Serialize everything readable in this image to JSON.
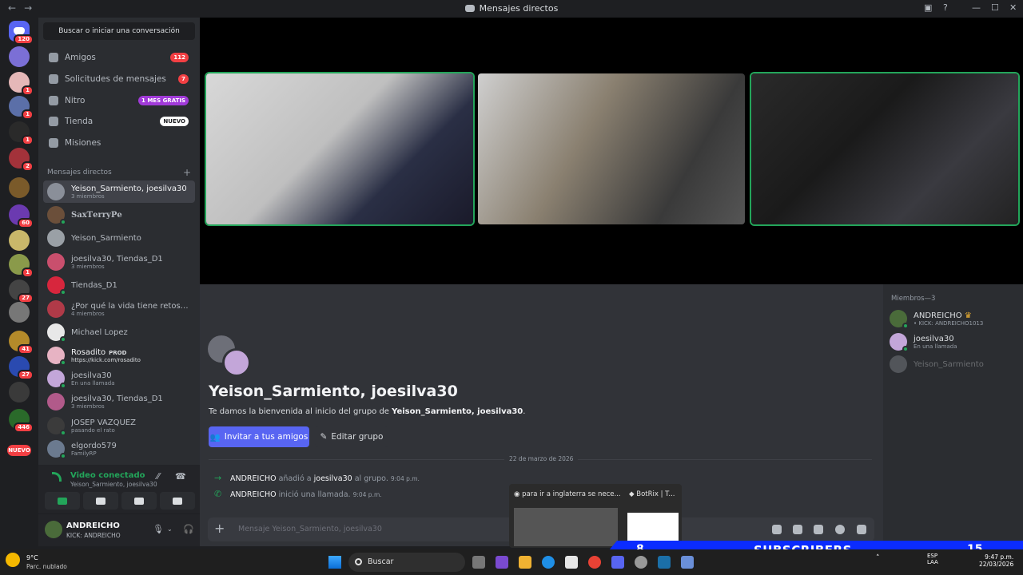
{
  "window": {
    "title": "Mensajes directos",
    "back": "←",
    "forward": "→",
    "minimize": "—",
    "maximize": "☐",
    "close": "✕"
  },
  "servers": {
    "home_badge": "120",
    "badges": [
      "1",
      "1",
      "1",
      "2",
      "60",
      "1",
      "27",
      "41",
      "27",
      "446"
    ],
    "new_label": "NUEVO"
  },
  "sidebar": {
    "search_label": "Buscar o iniciar una conversación",
    "nav": [
      {
        "label": "Amigos",
        "badge": "112",
        "icon": "friends-icon"
      },
      {
        "label": "Solicitudes de mensajes",
        "badge": "7",
        "icon": "message-request-icon"
      },
      {
        "label": "Nitro",
        "badge": "1 MES GRATIS",
        "icon": "nitro-icon"
      },
      {
        "label": "Tienda",
        "badge": "NUEVO",
        "icon": "shop-icon"
      },
      {
        "label": "Misiones",
        "badge": "",
        "icon": "quests-icon"
      }
    ],
    "dm_header": "Mensajes directos",
    "dm_add": "+",
    "dms": [
      {
        "name": "Yeison_Sarmiento, joesilva30",
        "sub": "3 miembros",
        "color": "#8a8f99"
      },
      {
        "name": "𝐒𝐚𝐱𝐓𝐞𝐫𝐫𝐲𝐏𝐞",
        "sub": "",
        "color": "#6b4f3a"
      },
      {
        "name": "Yeison_Sarmiento",
        "sub": "",
        "color": "#9aa0a6"
      },
      {
        "name": "joesilva30, Tiendas_D1",
        "sub": "3 miembros",
        "color": "#c94f6d"
      },
      {
        "name": "Tiendas_D1",
        "sub": "",
        "color": "#d7263d"
      },
      {
        "name": "¿Por qué la vida tiene retos?, Ti...",
        "sub": "4 miembros",
        "color": "#b03a48"
      },
      {
        "name": "Michael Lopez",
        "sub": "",
        "color": "#e8e8e8"
      },
      {
        "name": "Rosadito",
        "prod": "PROD",
        "sub": "https://kick.com/rosadito",
        "color": "#e7b3c3"
      },
      {
        "name": "joesilva30",
        "sub": "En una llamada",
        "color": "#c3a6d9"
      },
      {
        "name": "joesilva30, Tiendas_D1",
        "sub": "3 miembros",
        "color": "#b15a8a"
      },
      {
        "name": "JOSEP VAZQUEZ",
        "sub": "pasando el rato",
        "color": "#3b3b3b"
      },
      {
        "name": "elgordo579",
        "sub": "FamilyRP",
        "color": "#6b7a8f"
      }
    ]
  },
  "voice": {
    "status": "Video conectado",
    "channel": "Yeison_Sarmiento, joesilva30"
  },
  "user": {
    "name": "ANDREICHO",
    "status": "KICK: ANDREICHO"
  },
  "chat": {
    "group_title": "Yeison_Sarmiento, joesilva30",
    "welcome_prefix": "Te damos la bienvenida al inicio del grupo de ",
    "welcome_name": "Yeison_Sarmiento, joesilva30",
    "welcome_suffix": ".",
    "invite_button": "Invitar a tus amigos",
    "edit_button": "Editar grupo",
    "date": "22 de marzo de 2026",
    "messages": [
      {
        "user": "ANDREICHO",
        "action": " añadió a ",
        "target": "joesilva30",
        "rest": " al grupo.",
        "time": "9:04 p.m."
      },
      {
        "user": "ANDREICHO",
        "action": " inició una llamada.",
        "target": "",
        "rest": "",
        "time": "9:04 p.m."
      }
    ],
    "composer_placeholder": "Mensaje Yeison_Sarmiento, joesilva30"
  },
  "members": {
    "header": "Miembros—3",
    "list": [
      {
        "name": "ANDREICHO",
        "sub": "• KICK: ANDREICHO1013",
        "color": "#4a6b3a",
        "online": true
      },
      {
        "name": "joesilva30",
        "sub": "En una llamada",
        "color": "#c3a6d9",
        "online": true
      },
      {
        "name": "Yeison_Sarmiento",
        "sub": "",
        "color": "#9aa0a6",
        "online": false
      }
    ]
  },
  "preview": {
    "tab1": "para ir a inglaterra se nece...",
    "tab2": "BotRix | T..."
  },
  "overlay": {
    "left_number": "8",
    "label": "SUBSCRIBERS",
    "right_number": "15"
  },
  "taskbar": {
    "weather_temp": "9°C",
    "weather_desc": "Parc. nublado",
    "search": "Buscar",
    "lang1": "ESP",
    "lang2": "LAA",
    "time": "9:47 p.m.",
    "date": "22/03/2026"
  }
}
